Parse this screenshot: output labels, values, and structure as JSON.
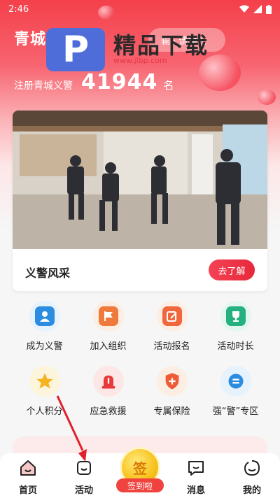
{
  "status": {
    "time": "2:46"
  },
  "header": {
    "title": "青城义警",
    "search_placeholder": "输 · 请输入",
    "registered_label": "注册青城义警",
    "registered_count": "41944",
    "registered_unit": "名"
  },
  "watermark": {
    "logo_letter": "P",
    "text": "精品下载",
    "url": "www.jlbp.com"
  },
  "feature_card": {
    "title": "义警风采",
    "button": "去了解"
  },
  "grid": [
    {
      "label": "成为义警",
      "icon": "person-badge-icon",
      "bg": "#e6f2fc",
      "fg": "#2c8de0"
    },
    {
      "label": "加入组织",
      "icon": "flag-icon",
      "bg": "#fdeee4",
      "fg": "#f07a3b"
    },
    {
      "label": "活动报名",
      "icon": "edit-form-icon",
      "bg": "#fdeee4",
      "fg": "#f0673d"
    },
    {
      "label": "活动时长",
      "icon": "trophy-icon",
      "bg": "#e3f6ef",
      "fg": "#25b07f"
    },
    {
      "label": "个人积分",
      "icon": "star-icon",
      "bg": "#fdf4dc",
      "fg": "#f5b320"
    },
    {
      "label": "应急救援",
      "icon": "siren-icon",
      "bg": "#fde6e6",
      "fg": "#e83a3a"
    },
    {
      "label": "专属保险",
      "icon": "shield-plus-icon",
      "bg": "#fdeee4",
      "fg": "#f05a35"
    },
    {
      "label": "强“警”专区",
      "icon": "chat-bubble-icon",
      "bg": "#e6f2fc",
      "fg": "#2c8de0"
    }
  ],
  "tabbar": {
    "home": "首页",
    "activity": "活动",
    "sign_char": "签",
    "sign_label": "签到啦",
    "messages": "消息",
    "mine": "我的"
  },
  "colors": {
    "primary": "#f0423e",
    "accent_pink": "#f76470"
  }
}
